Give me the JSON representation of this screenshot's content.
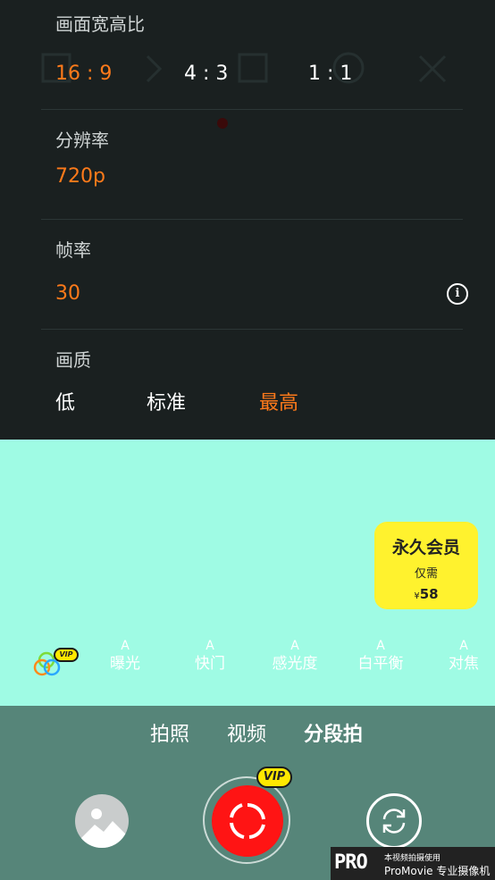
{
  "settings": {
    "aspect": {
      "label": "画面宽高比",
      "options": [
        "16 : 9",
        "4 : 3",
        "1 : 1"
      ],
      "selected": "16 : 9"
    },
    "resolution": {
      "label": "分辨率",
      "value": "720p"
    },
    "framerate": {
      "label": "帧率",
      "value": "30",
      "info_icon": "info-icon"
    },
    "quality": {
      "label": "画质",
      "options": [
        "低",
        "标准",
        "最高"
      ],
      "selected": "最高"
    }
  },
  "promo": {
    "title": "永久会员",
    "subtitle": "仅需",
    "currency": "¥",
    "price": "58"
  },
  "tools": {
    "filter_vip": "VIP",
    "items": [
      {
        "auto": "A",
        "label": "曝光"
      },
      {
        "auto": "A",
        "label": "快门"
      },
      {
        "auto": "A",
        "label": "感光度"
      },
      {
        "auto": "A",
        "label": "白平衡"
      },
      {
        "auto": "A",
        "label": "对焦"
      }
    ]
  },
  "modes": {
    "items": [
      "拍照",
      "视频",
      "分段拍"
    ],
    "selected": "分段拍"
  },
  "shutter": {
    "vip": "VIP"
  },
  "watermark": {
    "logo": "PRO",
    "line1": "本视频拍摄使用",
    "line2": "ProMovie 专业摄像机"
  },
  "colors": {
    "accent": "#ff7a1a",
    "panel": "#1a2020",
    "preview": "#9ffbe4",
    "bottom_bar": "#568579",
    "shutter": "#ff1414",
    "promo": "#fff22e"
  }
}
